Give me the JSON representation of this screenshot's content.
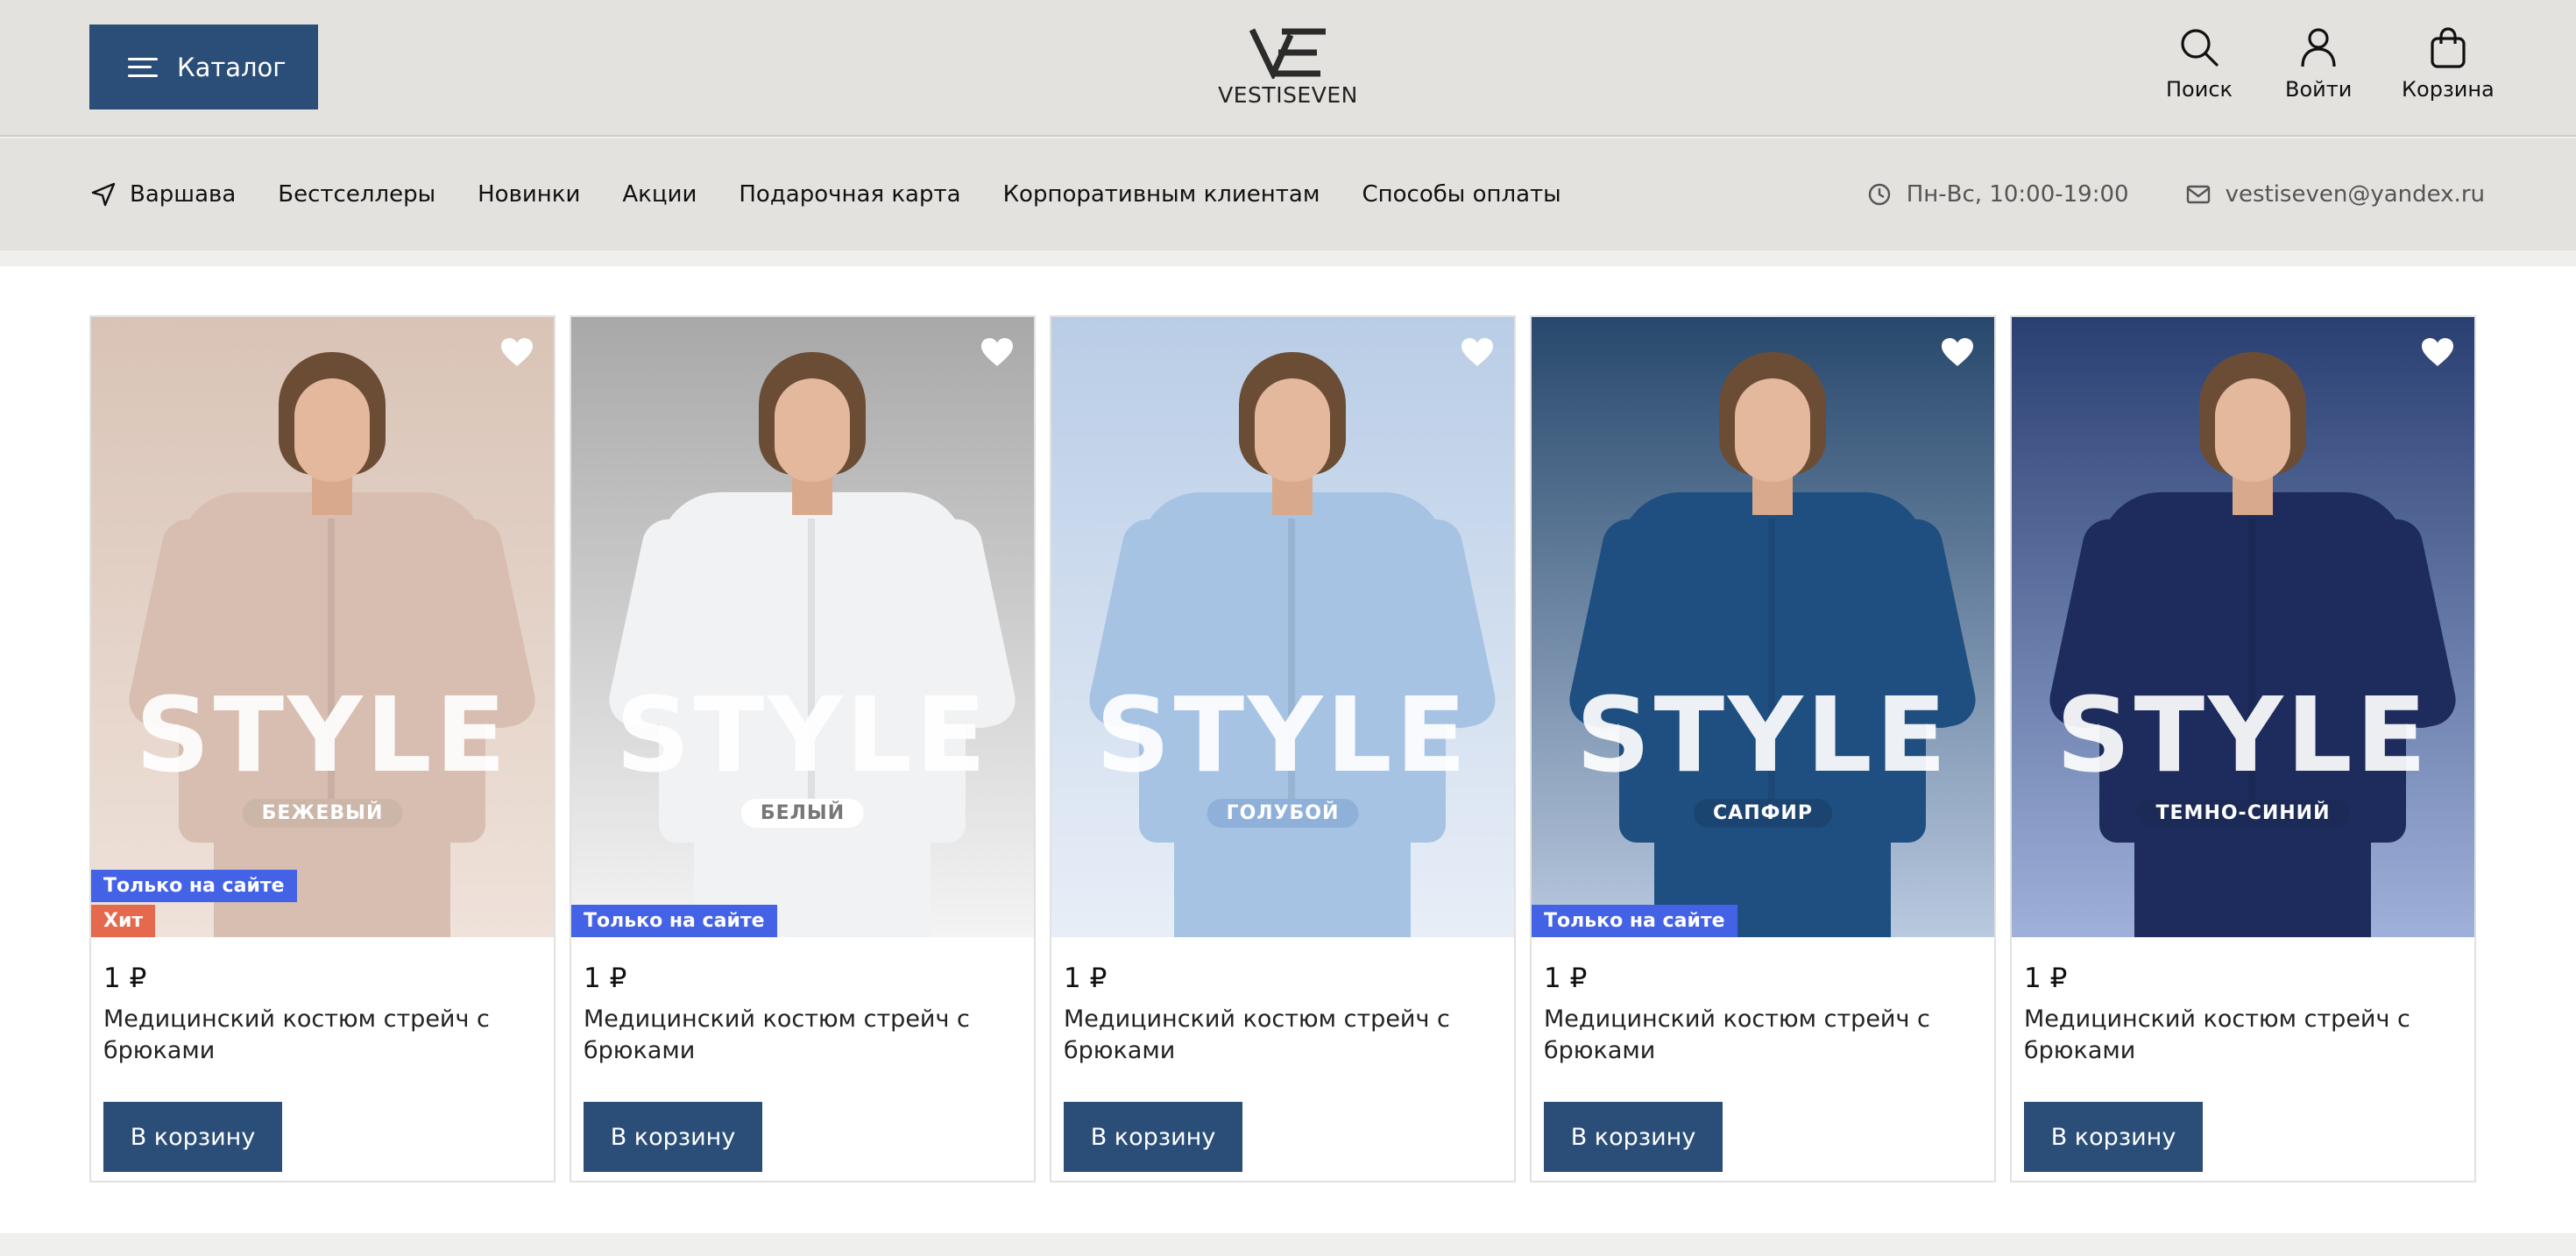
{
  "header": {
    "catalog_label": "Каталог",
    "logo_text": "VESTISEVEN",
    "actions": [
      {
        "label": "Поиск",
        "icon": "search-icon"
      },
      {
        "label": "Войти",
        "icon": "user-icon"
      },
      {
        "label": "Корзина",
        "icon": "bag-icon"
      }
    ],
    "brand_color": "#2a4e78"
  },
  "nav": {
    "city": "Варшава",
    "items": [
      "Бестселлеры",
      "Новинки",
      "Акции",
      "Подарочная карта",
      "Корпоративным клиентам",
      "Способы оплаты"
    ],
    "hours": "Пн-Вс, 10:00-19:00",
    "email": "vestiseven@yandex.ru"
  },
  "products": [
    {
      "price": "1 ₽",
      "name": "Медицинский костюм стрейч с брюками",
      "cart_label": "В корзину",
      "banner_word": "STYLE",
      "color_name": "БЕЖЕВЫЙ",
      "badges": [
        "Только на сайте",
        "Хит"
      ],
      "bg_top": "#d9c3b6",
      "bg_bottom": "#efe2da",
      "suit_color": "#d8beb1",
      "pill_bg": "#cbb6a8",
      "pill_text": "#ffffff"
    },
    {
      "price": "1 ₽",
      "name": "Медицинский костюм стрейч с брюками",
      "cart_label": "В корзину",
      "banner_word": "STYLE",
      "color_name": "БЕЛЫЙ",
      "badges": [
        "Только на сайте"
      ],
      "bg_top": "#a8a8a8",
      "bg_bottom": "#f4f4f4",
      "suit_color": "#f1f2f4",
      "pill_bg": "#ffffff",
      "pill_text": "#777777"
    },
    {
      "price": "1 ₽",
      "name": "Медицинский костюм стрейч с брюками",
      "cart_label": "В корзину",
      "banner_word": "STYLE",
      "color_name": "ГОЛУБОЙ",
      "badges": [],
      "bg_top": "#b9cde6",
      "bg_bottom": "#e8eef7",
      "suit_color": "#a7c3e4",
      "pill_bg": "#8fb0d8",
      "pill_text": "#ffffff"
    },
    {
      "price": "1 ₽",
      "name": "Медицинский костюм стрейч с брюками",
      "cart_label": "В корзину",
      "banner_word": "STYLE",
      "color_name": "САПФИР",
      "badges": [
        "Только на сайте"
      ],
      "bg_top": "#27486c",
      "bg_bottom": "#b9c9df",
      "suit_color": "#1e4f80",
      "pill_bg": "#1c4470",
      "pill_text": "#ffffff"
    },
    {
      "price": "1 ₽",
      "name": "Медицинский костюм стрейч с брюками",
      "cart_label": "В корзину",
      "banner_word": "STYLE",
      "color_name": "ТЕМНО-СИНИЙ",
      "badges": [],
      "bg_top": "#2a3f72",
      "bg_bottom": "#9fb1da",
      "suit_color": "#1d2c5c",
      "pill_bg": "#1b2a56",
      "pill_text": "#ffffff"
    }
  ],
  "badge_colors": {
    "site": "#4462e6",
    "hit": "#e5694c"
  }
}
